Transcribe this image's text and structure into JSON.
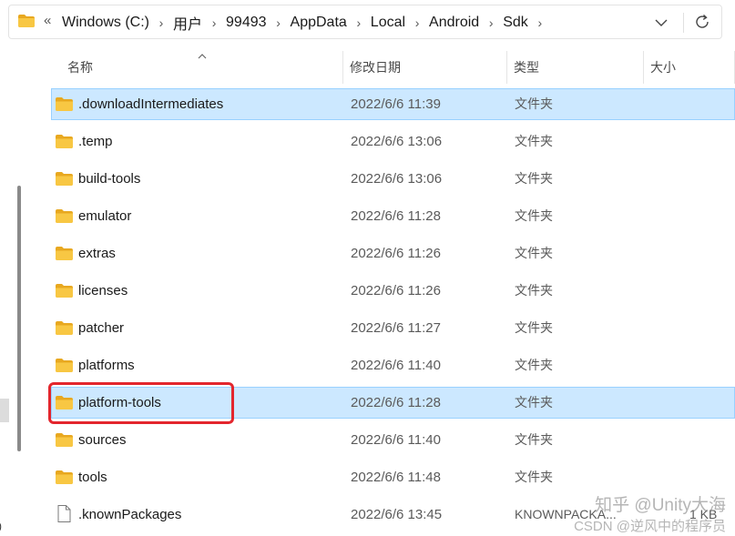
{
  "address_bar": {
    "overflow_label": "«",
    "breadcrumbs": [
      "Windows (C:)",
      "用户",
      "99493",
      "AppData",
      "Local",
      "Android",
      "Sdk"
    ],
    "separator": "›",
    "icons": {
      "location": "folder-icon",
      "history": "chevron-down-icon",
      "refresh": "refresh-icon"
    }
  },
  "columns": {
    "name": "名称",
    "modified": "修改日期",
    "type": "类型",
    "size": "大小"
  },
  "files": [
    {
      "name": ".downloadIntermediates",
      "modified": "2022/6/6 11:39",
      "type": "文件夹",
      "size": "",
      "icon": "folder-icon",
      "selected": true
    },
    {
      "name": ".temp",
      "modified": "2022/6/6 13:06",
      "type": "文件夹",
      "size": "",
      "icon": "folder-icon",
      "selected": false
    },
    {
      "name": "build-tools",
      "modified": "2022/6/6 13:06",
      "type": "文件夹",
      "size": "",
      "icon": "folder-icon",
      "selected": false
    },
    {
      "name": "emulator",
      "modified": "2022/6/6 11:28",
      "type": "文件夹",
      "size": "",
      "icon": "folder-icon",
      "selected": false
    },
    {
      "name": "extras",
      "modified": "2022/6/6 11:26",
      "type": "文件夹",
      "size": "",
      "icon": "folder-icon",
      "selected": false
    },
    {
      "name": "licenses",
      "modified": "2022/6/6 11:26",
      "type": "文件夹",
      "size": "",
      "icon": "folder-icon",
      "selected": false
    },
    {
      "name": "patcher",
      "modified": "2022/6/6 11:27",
      "type": "文件夹",
      "size": "",
      "icon": "folder-icon",
      "selected": false
    },
    {
      "name": "platforms",
      "modified": "2022/6/6 11:40",
      "type": "文件夹",
      "size": "",
      "icon": "folder-icon",
      "selected": false
    },
    {
      "name": "platform-tools",
      "modified": "2022/6/6 11:28",
      "type": "文件夹",
      "size": "",
      "icon": "folder-icon",
      "selected": true
    },
    {
      "name": "sources",
      "modified": "2022/6/6 11:40",
      "type": "文件夹",
      "size": "",
      "icon": "folder-icon",
      "selected": false
    },
    {
      "name": "tools",
      "modified": "2022/6/6 11:48",
      "type": "文件夹",
      "size": "",
      "icon": "folder-icon",
      "selected": false
    },
    {
      "name": ".knownPackages",
      "modified": "2022/6/6 13:45",
      "type": "KNOWNPACKA...",
      "size": "1 KB",
      "icon": "file-icon",
      "selected": false
    }
  ],
  "watermark": {
    "line1": "知乎 @Unity大海",
    "line2": "CSDN @逆风中的程序员"
  },
  "colors": {
    "selection_bg": "#cce8ff",
    "selection_border": "#99d1ff",
    "annotation_red": "#e3262d",
    "folder_yellow": "#f8c743"
  }
}
